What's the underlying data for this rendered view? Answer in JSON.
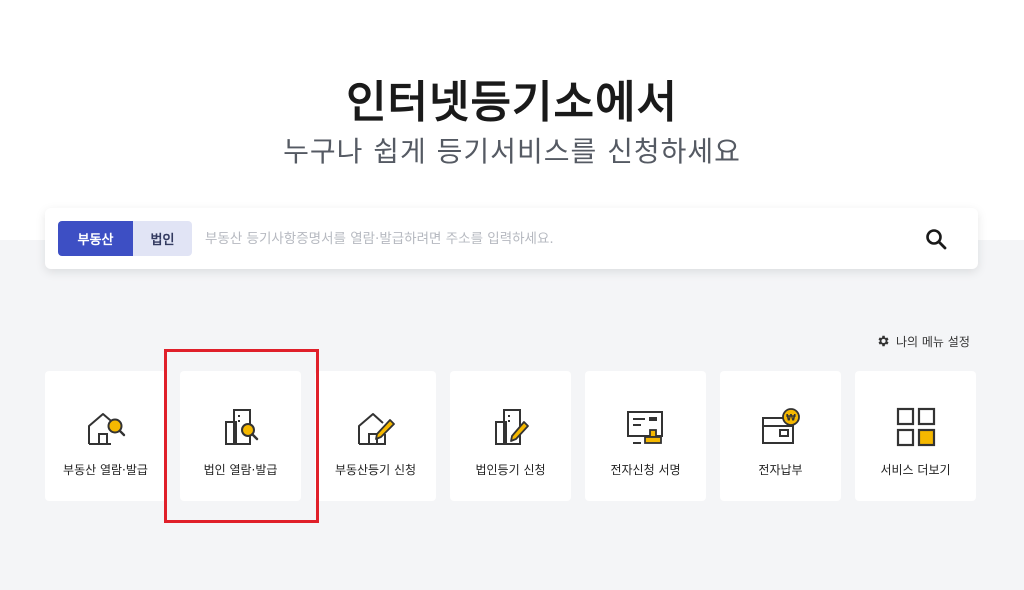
{
  "hero": {
    "title": "인터넷등기소에서",
    "subtitle": "누구나 쉽게 등기서비스를 신청하세요"
  },
  "search": {
    "tabs": [
      {
        "label": "부동산",
        "active": true
      },
      {
        "label": "법인",
        "active": false
      }
    ],
    "placeholder": "부동산 등기사항증명서를 열람·발급하려면 주소를 입력하세요.",
    "search_icon": "search-icon"
  },
  "my_menu": {
    "label": "나의 메뉴 설정",
    "icon": "gear-icon"
  },
  "services": [
    {
      "label": "부동산 열람·발급",
      "icon": "house-search-icon"
    },
    {
      "label": "법인 열람·발급",
      "icon": "building-search-icon"
    },
    {
      "label": "부동산등기 신청",
      "icon": "house-pen-icon"
    },
    {
      "label": "법인등기 신청",
      "icon": "building-pen-icon"
    },
    {
      "label": "전자신청 서명",
      "icon": "document-stamp-icon"
    },
    {
      "label": "전자납부",
      "icon": "wallet-won-icon"
    },
    {
      "label": "서비스 더보기",
      "icon": "grid-more-icon"
    }
  ],
  "colors": {
    "accent": "#3d4fc4",
    "accent_light": "#e1e4f5",
    "icon_line": "#333333",
    "icon_fill": "#f5b800",
    "highlight": "#e0202a",
    "section_bg": "#f4f5f7"
  }
}
